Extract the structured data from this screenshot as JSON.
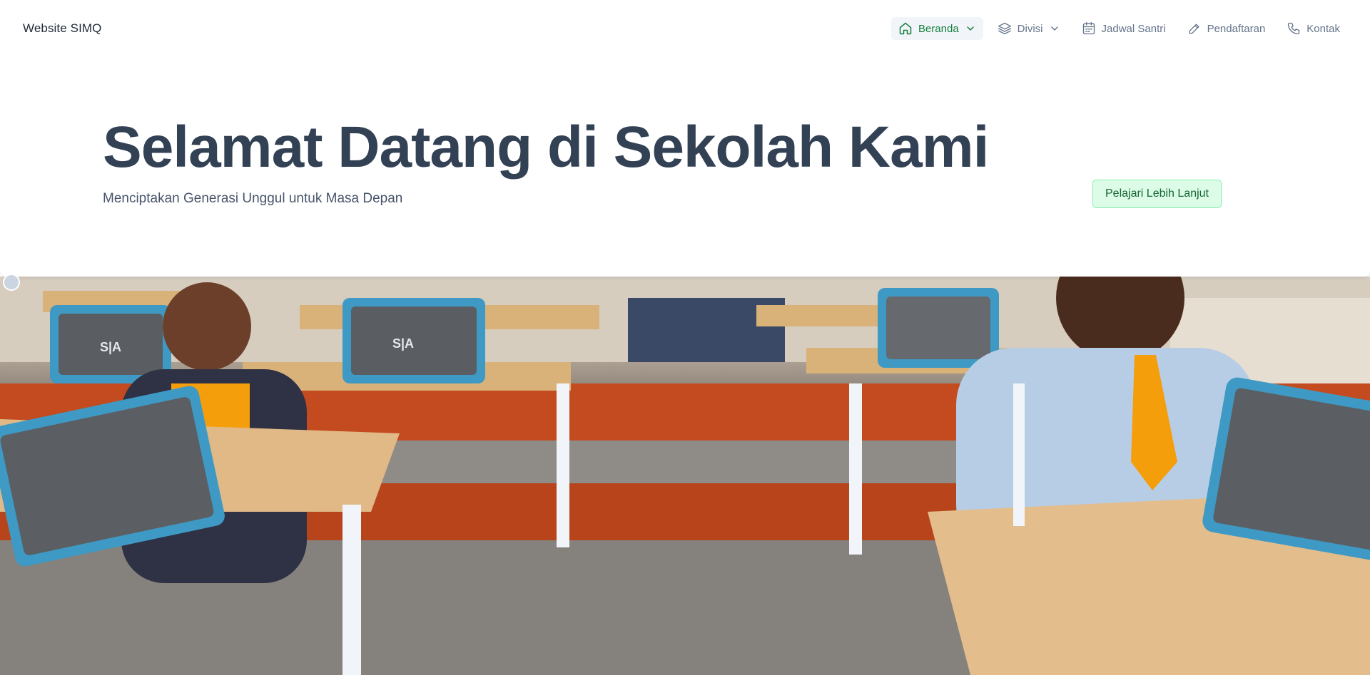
{
  "brand": {
    "title": "Website SIMQ"
  },
  "nav": {
    "items": [
      {
        "label": "Beranda",
        "icon": "home-icon",
        "active": true,
        "dropdown": true
      },
      {
        "label": "Divisi",
        "icon": "layers-icon",
        "active": false,
        "dropdown": true
      },
      {
        "label": "Jadwal Santri",
        "icon": "calendar-icon",
        "active": false,
        "dropdown": false
      },
      {
        "label": "Pendaftaran",
        "icon": "pencil-icon",
        "active": false,
        "dropdown": false
      },
      {
        "label": "Kontak",
        "icon": "phone-icon",
        "active": false,
        "dropdown": false
      }
    ]
  },
  "hero": {
    "title": "Selamat Datang di Sekolah Kami",
    "subtitle": "Menciptakan Generasi Unggul untuk Masa Depan",
    "cta_label": "Pelajari Lebih Lanjut"
  },
  "colors": {
    "accent": "#15803d",
    "cta_background": "#dcfce7",
    "title_text": "#334155"
  }
}
